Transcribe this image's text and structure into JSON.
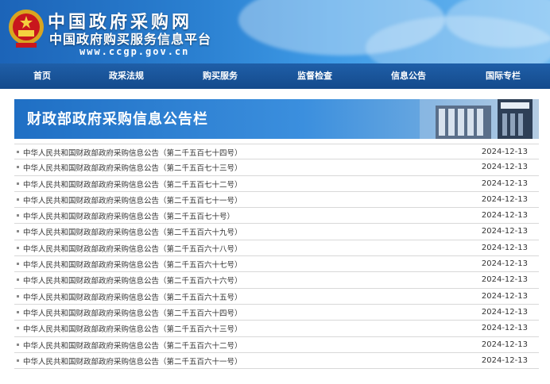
{
  "header": {
    "title": "中国政府采购网",
    "subtitle": "中国政府购买服务信息平台",
    "url": "www.ccgp.gov.cn"
  },
  "nav": {
    "items": [
      {
        "label": "首页"
      },
      {
        "label": "政采法规"
      },
      {
        "label": "购买服务"
      },
      {
        "label": "监督检查"
      },
      {
        "label": "信息公告"
      },
      {
        "label": "国际专栏"
      }
    ]
  },
  "board": {
    "title": "财政部政府采购信息公告栏"
  },
  "notices": [
    {
      "title": "中华人民共和国财政部政府采购信息公告（第二千五百七十四号）",
      "date": "2024-12-13"
    },
    {
      "title": "中华人民共和国财政部政府采购信息公告（第二千五百七十三号）",
      "date": "2024-12-13"
    },
    {
      "title": "中华人民共和国财政部政府采购信息公告（第二千五百七十二号）",
      "date": "2024-12-13"
    },
    {
      "title": "中华人民共和国财政部政府采购信息公告（第二千五百七十一号）",
      "date": "2024-12-13"
    },
    {
      "title": "中华人民共和国财政部政府采购信息公告（第二千五百七十号）",
      "date": "2024-12-13"
    },
    {
      "title": "中华人民共和国财政部政府采购信息公告（第二千五百六十九号）",
      "date": "2024-12-13"
    },
    {
      "title": "中华人民共和国财政部政府采购信息公告（第二千五百六十八号）",
      "date": "2024-12-13"
    },
    {
      "title": "中华人民共和国财政部政府采购信息公告（第二千五百六十七号）",
      "date": "2024-12-13"
    },
    {
      "title": "中华人民共和国财政部政府采购信息公告（第二千五百六十六号）",
      "date": "2024-12-13"
    },
    {
      "title": "中华人民共和国财政部政府采购信息公告（第二千五百六十五号）",
      "date": "2024-12-13"
    },
    {
      "title": "中华人民共和国财政部政府采购信息公告（第二千五百六十四号）",
      "date": "2024-12-13"
    },
    {
      "title": "中华人民共和国财政部政府采购信息公告（第二千五百六十三号）",
      "date": "2024-12-13"
    },
    {
      "title": "中华人民共和国财政部政府采购信息公告（第二千五百六十二号）",
      "date": "2024-12-13"
    },
    {
      "title": "中华人民共和国财政部政府采购信息公告（第二千五百六十一号）",
      "date": "2024-12-13"
    }
  ]
}
